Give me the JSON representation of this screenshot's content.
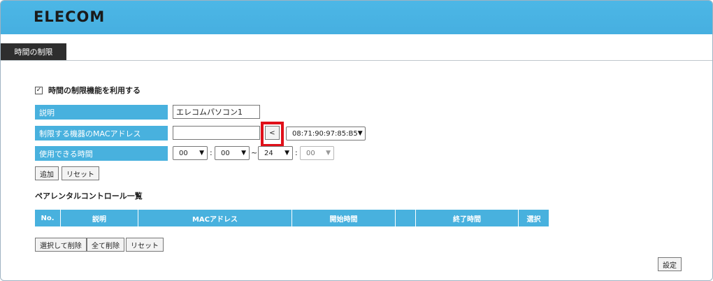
{
  "brand": {
    "logo": "ELECOM"
  },
  "tab": {
    "label": "時間の制限"
  },
  "enable": {
    "label": "時間の制限機能を利用する",
    "checked": true
  },
  "form": {
    "description": {
      "label": "説明",
      "value": "エレコムパソコン1"
    },
    "mac": {
      "label": "制限する機器のMACアドレス",
      "value": "",
      "copy_button": "<",
      "selected_device": "08:71:90:97:85:B5"
    },
    "time": {
      "label": "使用できる時間",
      "start_hour": "00",
      "start_minute": "00",
      "colon": ":",
      "tilde": "~",
      "end_hour": "24",
      "end_minute": "00"
    },
    "add_button": "追加",
    "reset_button": "リセット"
  },
  "list": {
    "title": "ペアレンタルコントロール一覧",
    "columns": [
      "No.",
      "説明",
      "MACアドレス",
      "開始時間",
      "",
      "終了時間",
      "選択"
    ]
  },
  "list_actions": {
    "delete_selected": "選択して削除",
    "delete_all": "全て削除",
    "reset": "リセット"
  },
  "footer": {
    "apply_button": "設定"
  },
  "colors": {
    "banner": "#46afe0",
    "label_bg": "#48b1de",
    "tab_bg": "#2e2e2e",
    "highlight": "#e0101a"
  }
}
